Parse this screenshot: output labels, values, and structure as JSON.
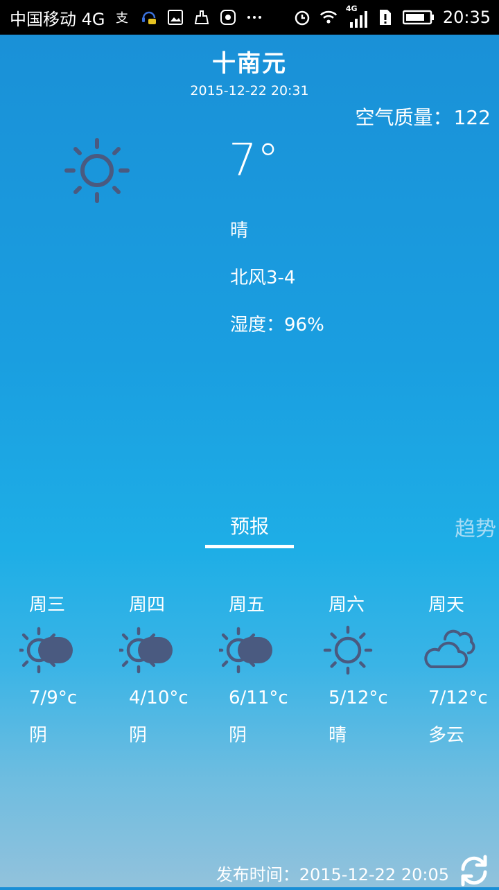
{
  "status_bar": {
    "carrier": "中国移动 4G",
    "time": "20:35",
    "network_badge": "4G",
    "left_icons": [
      "alipay-icon",
      "headset-chat-icon",
      "image-icon",
      "cleaner-icon",
      "huawei-app-icon",
      "more-icon"
    ],
    "right_icons": [
      "alarm-icon",
      "wifi-icon",
      "signal-icon",
      "sim-alert-icon",
      "battery-icon"
    ]
  },
  "header": {
    "city": "十南元",
    "publish_datetime": "2015-12-22 20:31",
    "air_quality_label": "空气质量：",
    "air_quality_value": "122"
  },
  "current": {
    "icon": "sun-icon",
    "temperature": "7°",
    "condition": "晴",
    "wind": "北风3-4",
    "humidity": "湿度：96%"
  },
  "tabs": {
    "forecast": "预报",
    "trend": "趋势",
    "active": "forecast"
  },
  "forecast": [
    {
      "day": "周三",
      "temps": "7/9°c",
      "condition": "阴",
      "icon": "overcast"
    },
    {
      "day": "周四",
      "temps": "4/10°c",
      "condition": "阴",
      "icon": "overcast"
    },
    {
      "day": "周五",
      "temps": "6/11°c",
      "condition": "阴",
      "icon": "overcast"
    },
    {
      "day": "周六",
      "temps": "5/12°c",
      "condition": "晴",
      "icon": "sunny"
    },
    {
      "day": "周天",
      "temps": "7/12°c",
      "condition": "多云",
      "icon": "cloudy"
    }
  ],
  "footer": {
    "published": "发布时间：2015-12-22 20:05"
  },
  "colors": {
    "icon_color": "#4a5a80",
    "trend_tab_color": "#a8dcf5"
  }
}
